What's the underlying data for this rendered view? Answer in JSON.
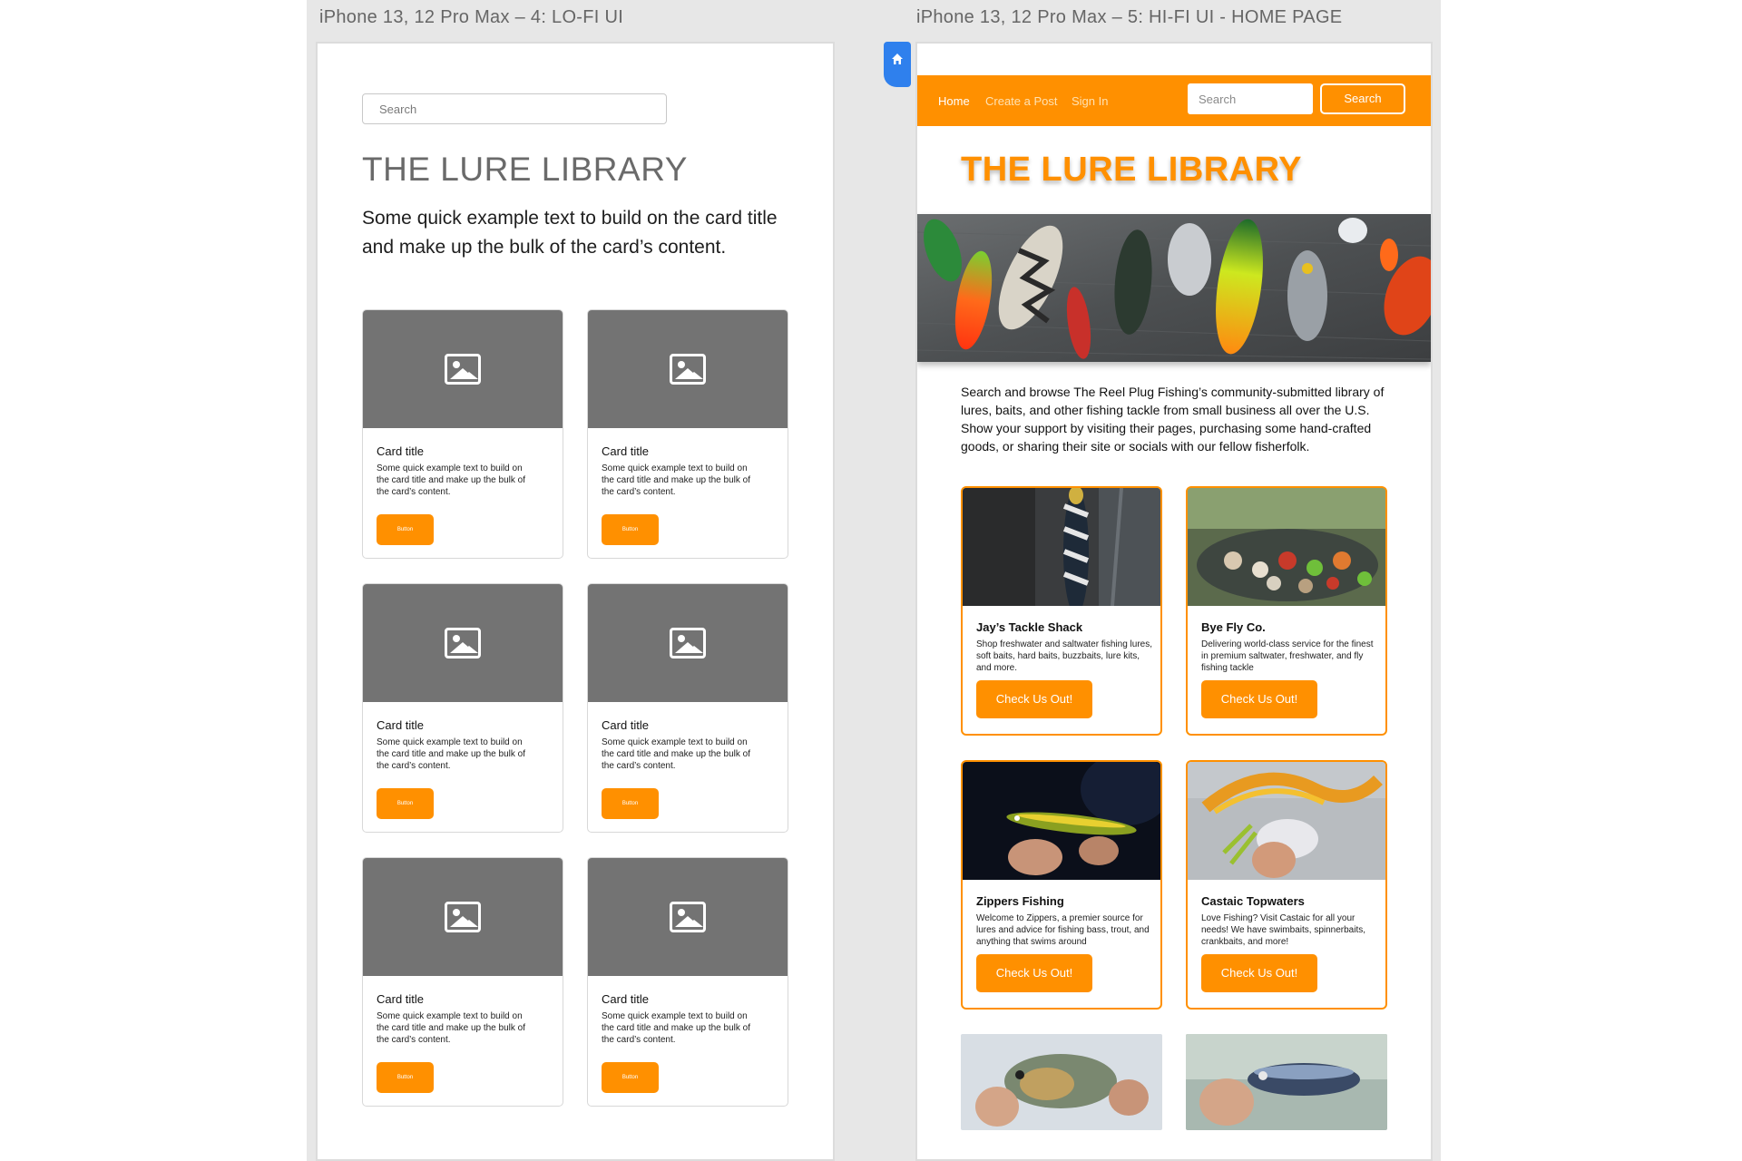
{
  "frames": {
    "lofi_label": "iPhone 13, 12 Pro Max – 4: LO-FI UI",
    "hifi_label": "iPhone 13, 12 Pro Max – 5: HI-FI UI - HOME PAGE"
  },
  "lofi": {
    "search_placeholder": "Search",
    "title": "THE LURE LIBRARY",
    "lead": "Some quick example text to build  on the card title and make up the bulk of the card’s content.",
    "cards": [
      {
        "title": "Card title",
        "text": "Some quick example text to build on the card title and make up the bulk of the card’s content.",
        "button": "Button"
      },
      {
        "title": "Card title",
        "text": "Some quick example text to build on the card title and make up the bulk of the card’s content.",
        "button": "Button"
      },
      {
        "title": "Card title",
        "text": "Some quick example text to build on the card title and make up the bulk of the card’s content.",
        "button": "Button"
      },
      {
        "title": "Card title",
        "text": "Some quick example text to build on the card title and make up the bulk of the card’s content.",
        "button": "Button"
      },
      {
        "title": "Card title",
        "text": "Some quick example text to build on the card title and make up the bulk of the card’s content.",
        "button": "Button"
      },
      {
        "title": "Card title",
        "text": "Some quick example text to build on the card title and make up the bulk of the card’s content.",
        "button": "Button"
      }
    ]
  },
  "hifi": {
    "nav": {
      "home": "Home",
      "create": "Create a Post",
      "signin": "Sign In",
      "search_placeholder": "Search",
      "search_button": "Search"
    },
    "title": "THE LURE LIBRARY",
    "intro": "Search and browse The Reel Plug Fishing’s community-submitted library of lures, baits, and other fishing tackle from small business all over the U.S. Show your support by visiting their pages, purchasing some hand-crafted goods, or sharing their site or socials with our fellow fisherfolk.",
    "cards": [
      {
        "title": "Jay’s Tackle Shack",
        "text": "Shop freshwater and saltwater fishing lures, soft baits, hard baits, buzzbaits, lure kits, and more.",
        "button": "Check Us Out!"
      },
      {
        "title": "Bye Fly Co.",
        "text": "Delivering world-class service for the finest in premium saltwater, freshwater, and fly fishing tackle",
        "button": "Check Us Out!"
      },
      {
        "title": "Zippers Fishing",
        "text": "Welcome to Zippers, a premier source for lures and advice for fishing bass, trout, and anything that swims around",
        "button": "Check Us Out!"
      },
      {
        "title": "Castaic Topwaters",
        "text": "Love Fishing? Visit Castaic for all your needs! We have swimbaits, spinnerbaits, crankbaits, and more!",
        "button": "Check Us Out!"
      }
    ]
  },
  "colors": {
    "accent": "#ff9000",
    "home_tab": "#2f80ed",
    "placeholder_gray": "#737373"
  },
  "icons": [
    "home-icon",
    "image-placeholder-icon"
  ]
}
